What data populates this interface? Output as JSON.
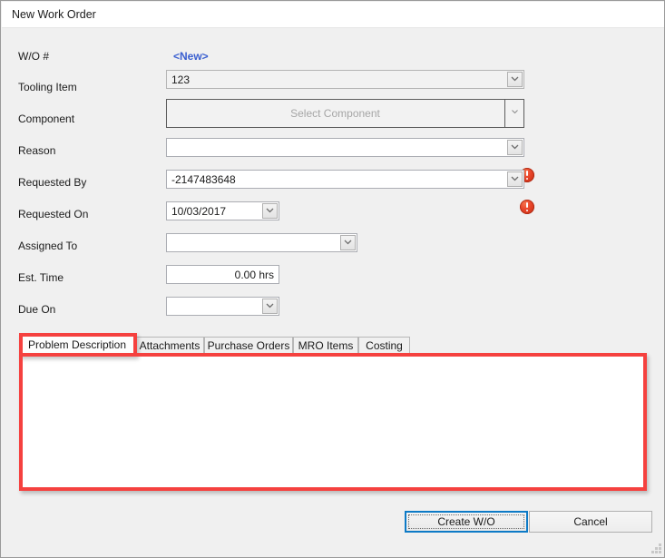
{
  "window": {
    "title": "New Work Order"
  },
  "form": {
    "wo_number": {
      "label": "W/O #",
      "value": "<New>"
    },
    "tooling_item": {
      "label": "Tooling Item",
      "value": "123"
    },
    "component": {
      "label": "Component",
      "placeholder": "Select Component",
      "value": ""
    },
    "reason": {
      "label": "Reason",
      "value": "",
      "error": true
    },
    "requested_by": {
      "label": "Requested By",
      "value": "-2147483648",
      "error": true
    },
    "requested_on": {
      "label": "Requested On",
      "value": "10/03/2017"
    },
    "assigned_to": {
      "label": "Assigned To",
      "value": ""
    },
    "est_time": {
      "label": "Est. Time",
      "value": "0.00 hrs"
    },
    "due_on": {
      "label": "Due On",
      "value": ""
    }
  },
  "tabs": [
    {
      "label": "Problem Description",
      "selected": true
    },
    {
      "label": "Attachments",
      "selected": false
    },
    {
      "label": "Purchase Orders",
      "selected": false
    },
    {
      "label": "MRO Items",
      "selected": false
    },
    {
      "label": "Costing",
      "selected": false
    }
  ],
  "editor": {
    "content": ""
  },
  "buttons": {
    "create": "Create W/O",
    "cancel": "Cancel"
  },
  "colors": {
    "annotation_red": "#f5413f",
    "link_blue": "#3a5fd0",
    "focus_blue": "#0d7ac6",
    "error_icon_red": "#e8452a"
  }
}
